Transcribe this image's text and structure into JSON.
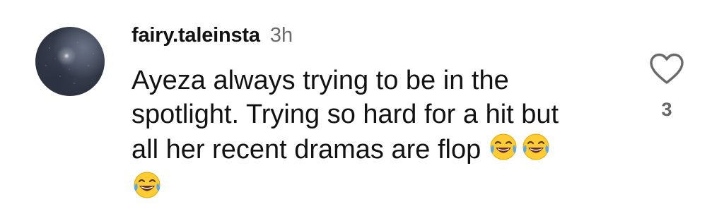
{
  "comment": {
    "username": "fairy.taleinsta",
    "timestamp": "3h",
    "text": "Ayeza always trying to be in the\nspotlight. Trying so hard for a hit but\nall her recent dramas are flop",
    "emoji": "face-with-tears-of-joy",
    "emoji_count": 3,
    "like_count": "3"
  },
  "icons": {
    "like": "heart-outline-icon",
    "avatar": "profile-avatar"
  },
  "colors": {
    "text": "#121212",
    "muted": "#6b6b6b",
    "count": "#666666",
    "emoji_face": "#ffcc33",
    "emoji_tear": "#5aa9e6"
  }
}
